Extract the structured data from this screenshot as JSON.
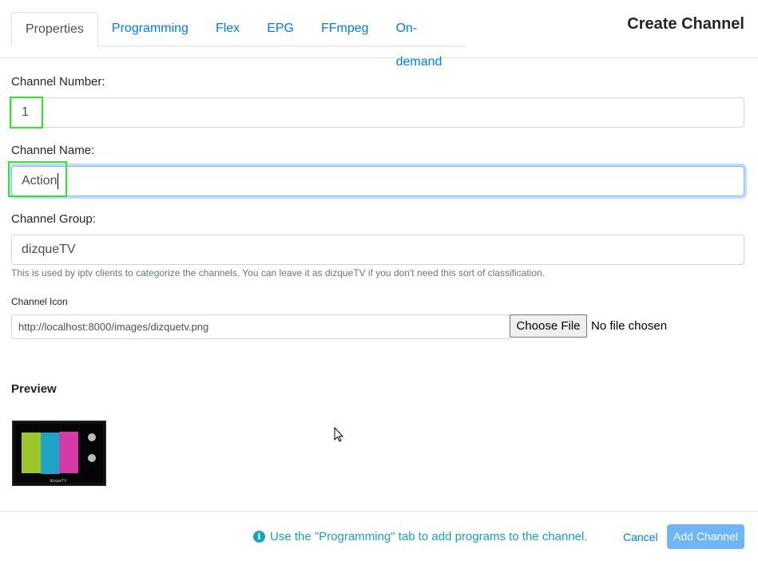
{
  "header": {
    "tabs": [
      {
        "label": "Properties",
        "active": true
      },
      {
        "label": "Programming"
      },
      {
        "label": "Flex"
      },
      {
        "label": "EPG"
      },
      {
        "label": "FFmpeg"
      },
      {
        "label": "On-demand"
      }
    ],
    "title": "Create Channel"
  },
  "form": {
    "channel_number": {
      "label": "Channel Number:",
      "value": "1"
    },
    "channel_name": {
      "label": "Channel Name:",
      "value": "Action"
    },
    "channel_group": {
      "label": "Channel Group:",
      "value": "dizqueTV",
      "help": "This is used by iptv clients to categorize the channels. You can leave it as dizqueTV if you don't need this sort of classification."
    },
    "channel_icon": {
      "label": "Channel Icon",
      "value": "http://localhost:8000/images/dizquetv.png",
      "file_button": "Choose File",
      "file_status": "No file chosen"
    }
  },
  "preview": {
    "title": "Preview",
    "tv_caption": "dizqueTV",
    "bar_colors": [
      "#9dc62a",
      "#1fa3c7",
      "#d63aa8"
    ]
  },
  "footer": {
    "note": "Use the \"Programming\" tab to add programs to the channel.",
    "info_icon": "i",
    "cancel_label": "Cancel",
    "add_label": "Add Channel"
  }
}
